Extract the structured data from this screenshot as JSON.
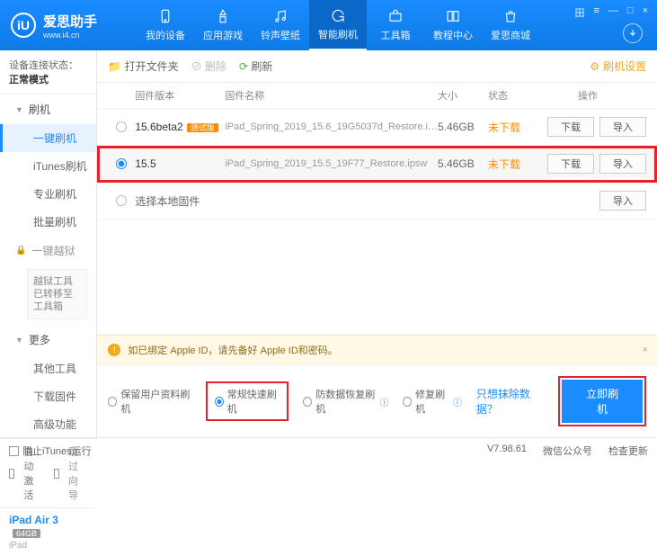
{
  "brand": {
    "cn": "爱思助手",
    "en": "www.i4.cn",
    "logo_glyph": "iU"
  },
  "win_controls": [
    "田",
    "≡",
    "—",
    "□",
    "×"
  ],
  "nav": {
    "items": [
      {
        "label": "我的设备"
      },
      {
        "label": "应用游戏"
      },
      {
        "label": "铃声壁纸"
      },
      {
        "label": "智能刷机",
        "active": true
      },
      {
        "label": "工具箱"
      },
      {
        "label": "教程中心"
      },
      {
        "label": "爱思商城"
      }
    ]
  },
  "sidebar": {
    "conn_label": "设备连接状态：",
    "conn_value": "正常模式",
    "g_flash": "刷机",
    "items_flash": [
      "一键刷机",
      "iTunes刷机",
      "专业刷机",
      "批量刷机"
    ],
    "active_flash_idx": 0,
    "g_jail": "一键越狱",
    "jail_notice": "越狱工具已转移至\n工具箱",
    "g_more": "更多",
    "items_more": [
      "其他工具",
      "下载固件",
      "高级功能"
    ],
    "auto_act": "自动激活",
    "skip_guide": "跳过向导",
    "device": {
      "name": "iPad Air 3",
      "storage": "64GB",
      "type": "iPad"
    }
  },
  "toolbar": {
    "open_folder": "打开文件夹",
    "delete": "删除",
    "refresh": "刷新",
    "settings": "刷机设置"
  },
  "columns": {
    "ver": "固件版本",
    "name": "固件名称",
    "size": "大小",
    "state": "状态",
    "act": "操作"
  },
  "rows": [
    {
      "selected": false,
      "version": "15.6beta2",
      "badge": "测试版",
      "filename": "iPad_Spring_2019_15.6_19G5037d_Restore.i…",
      "size": "5.46GB",
      "state": "未下载",
      "download": "下载",
      "import": "导入",
      "highlight": false
    },
    {
      "selected": true,
      "version": "15.5",
      "badge": "",
      "filename": "iPad_Spring_2019_15.5_19F77_Restore.ipsw",
      "size": "5.46GB",
      "state": "未下载",
      "download": "下载",
      "import": "导入",
      "highlight": true
    }
  ],
  "local_row": {
    "label": "选择本地固件",
    "import": "导入"
  },
  "warning": {
    "text": "如已绑定 Apple ID，请先备好 Apple ID和密码。"
  },
  "options": {
    "keep_data": "保留用户资料刷机",
    "normal_fast": "常规快速刷机",
    "anti_recovery": "防数据恢复刷机",
    "repair": "修复刷机",
    "erase_link": "只想抹除数据？",
    "go": "立即刷机"
  },
  "statusbar": {
    "block_itunes": "阻止iTunes运行",
    "version": "V7.98.61",
    "wechat": "微信公众号",
    "check_update": "检查更新"
  }
}
